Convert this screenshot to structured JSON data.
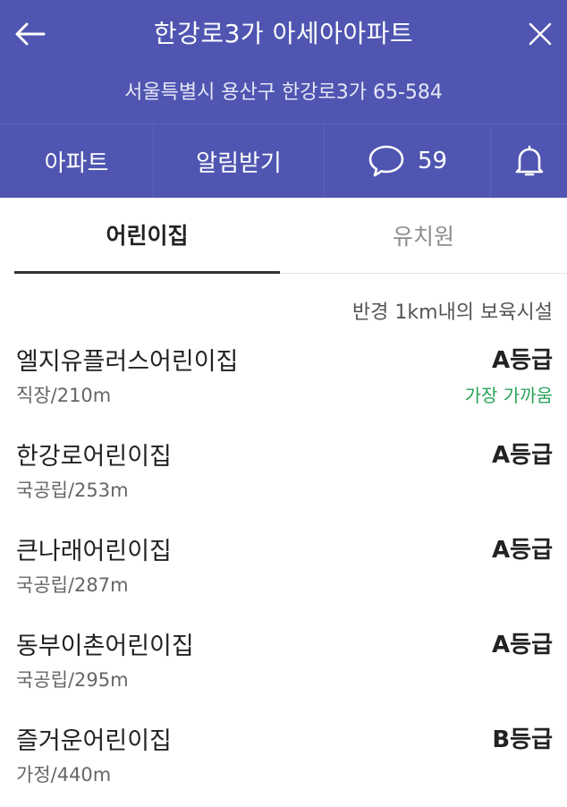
{
  "header": {
    "title": "한강로3가 아세아아파트",
    "address": "서울특별시 용산구 한강로3가 65-584"
  },
  "toolbar": {
    "apartment_label": "아파트",
    "notify_label": "알림받기",
    "comment_count": "59"
  },
  "tabs": [
    {
      "label": "어린이집",
      "active": true
    },
    {
      "label": "유치원",
      "active": false
    }
  ],
  "radius_note": "반경 1km내의 보육시설",
  "facilities": [
    {
      "name": "엘지유플러스어린이집",
      "type": "직장/210m",
      "grade": "A등급",
      "note": "가장 가까움"
    },
    {
      "name": "한강로어린이집",
      "type": "국공립/253m",
      "grade": "A등급",
      "note": ""
    },
    {
      "name": "큰나래어린이집",
      "type": "국공립/287m",
      "grade": "A등급",
      "note": ""
    },
    {
      "name": "동부이촌어린이집",
      "type": "국공립/295m",
      "grade": "A등급",
      "note": ""
    },
    {
      "name": "즐거운어린이집",
      "type": "가정/440m",
      "grade": "B등급",
      "note": ""
    }
  ],
  "colors": {
    "header_bg": "#4f55b1",
    "nearest_note": "#2aa45a"
  },
  "icons": {
    "back": "arrow-left-icon",
    "close": "close-icon",
    "comment": "speech-bubble-icon",
    "bell": "bell-icon"
  }
}
